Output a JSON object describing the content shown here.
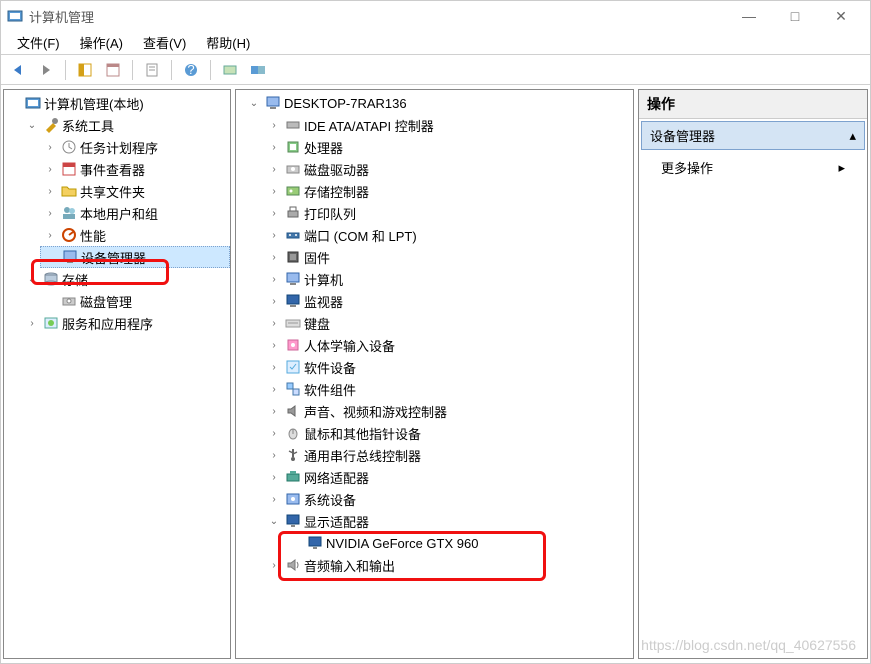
{
  "window": {
    "title": "计算机管理",
    "controls": {
      "minimize": "—",
      "maximize": "□",
      "close": "✕"
    }
  },
  "menubar": [
    {
      "label": "文件(F)"
    },
    {
      "label": "操作(A)"
    },
    {
      "label": "查看(V)"
    },
    {
      "label": "帮助(H)"
    }
  ],
  "left_tree": {
    "root": "计算机管理(本地)",
    "nodes": [
      {
        "label": "系统工具",
        "expanded": true,
        "icon": "tools",
        "children": [
          {
            "label": "任务计划程序",
            "icon": "task",
            "has_children": true
          },
          {
            "label": "事件查看器",
            "icon": "event",
            "has_children": true
          },
          {
            "label": "共享文件夹",
            "icon": "shared",
            "has_children": true
          },
          {
            "label": "本地用户和组",
            "icon": "users",
            "has_children": true
          },
          {
            "label": "性能",
            "icon": "perf",
            "has_children": true
          },
          {
            "label": "设备管理器",
            "icon": "device",
            "has_children": false,
            "selected": true
          }
        ]
      },
      {
        "label": "存储",
        "expanded": true,
        "icon": "storage",
        "children": [
          {
            "label": "磁盘管理",
            "icon": "disk",
            "has_children": false
          }
        ]
      },
      {
        "label": "服务和应用程序",
        "expanded": false,
        "icon": "services",
        "has_children": true
      }
    ]
  },
  "center_tree": {
    "root": "DESKTOP-7RAR136",
    "nodes": [
      {
        "label": "IDE ATA/ATAPI 控制器",
        "icon": "ide",
        "has_children": true
      },
      {
        "label": "处理器",
        "icon": "cpu",
        "has_children": true
      },
      {
        "label": "磁盘驱动器",
        "icon": "disk",
        "has_children": true
      },
      {
        "label": "存储控制器",
        "icon": "storage-ctrl",
        "has_children": true
      },
      {
        "label": "打印队列",
        "icon": "printer",
        "has_children": true
      },
      {
        "label": "端口 (COM 和 LPT)",
        "icon": "port",
        "has_children": true
      },
      {
        "label": "固件",
        "icon": "firmware",
        "has_children": true
      },
      {
        "label": "计算机",
        "icon": "computer",
        "has_children": true
      },
      {
        "label": "监视器",
        "icon": "monitor",
        "has_children": true
      },
      {
        "label": "键盘",
        "icon": "keyboard",
        "has_children": true
      },
      {
        "label": "人体学输入设备",
        "icon": "hid",
        "has_children": true
      },
      {
        "label": "软件设备",
        "icon": "software",
        "has_children": true
      },
      {
        "label": "软件组件",
        "icon": "software-comp",
        "has_children": true
      },
      {
        "label": "声音、视频和游戏控制器",
        "icon": "audio",
        "has_children": true
      },
      {
        "label": "鼠标和其他指针设备",
        "icon": "mouse",
        "has_children": true
      },
      {
        "label": "通用串行总线控制器",
        "icon": "usb",
        "has_children": true
      },
      {
        "label": "网络适配器",
        "icon": "network",
        "has_children": true
      },
      {
        "label": "系统设备",
        "icon": "system",
        "has_children": true
      },
      {
        "label": "显示适配器",
        "icon": "display",
        "expanded": true,
        "children": [
          {
            "label": "NVIDIA GeForce GTX 960",
            "icon": "display"
          }
        ]
      },
      {
        "label": "音频输入和输出",
        "icon": "audio-io",
        "has_children": true
      }
    ]
  },
  "right_panel": {
    "header": "操作",
    "section": "设备管理器",
    "items": [
      {
        "label": "更多操作",
        "submenu": true
      }
    ]
  },
  "watermark": "https://blog.csdn.net/qq_40627556"
}
